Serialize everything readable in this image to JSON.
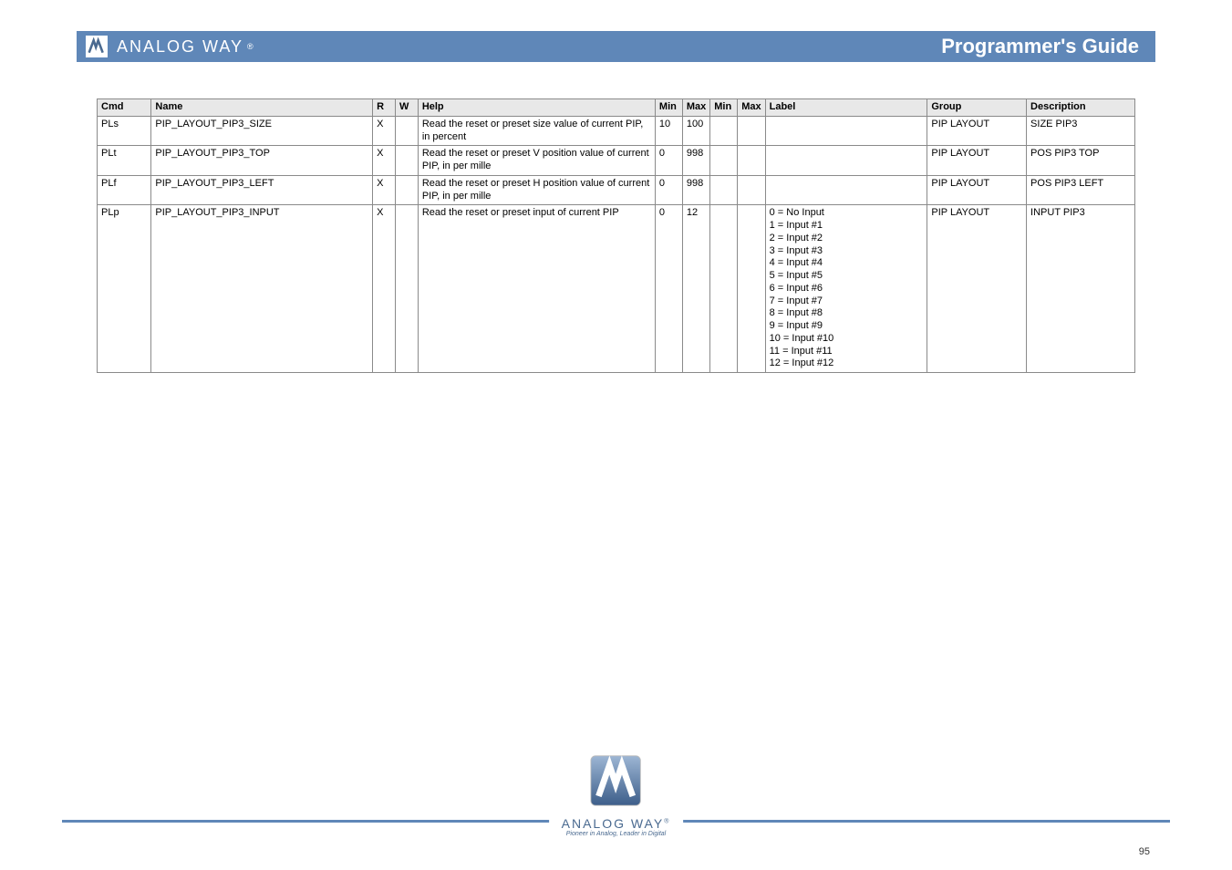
{
  "header": {
    "brand": "ANALOG WAY",
    "brand_suffix": "®",
    "title": "Programmer's Guide"
  },
  "table": {
    "headers": [
      "Cmd",
      "Name",
      "R",
      "W",
      "Help",
      "Min",
      "Max",
      "Min",
      "Max",
      "Label",
      "Group",
      "Description"
    ],
    "rows": [
      {
        "cmd": "PLs",
        "name": "PIP_LAYOUT_PIP3_SIZE",
        "r": "X",
        "w": "",
        "help": "Read the reset or preset size value of current PIP, in percent",
        "min": "10",
        "max": "100",
        "min2": "",
        "max2": "",
        "label": "",
        "group": "PIP LAYOUT",
        "desc": "SIZE PIP3"
      },
      {
        "cmd": "PLt",
        "name": "PIP_LAYOUT_PIP3_TOP",
        "r": "X",
        "w": "",
        "help": "Read the reset or preset V position value of current PIP, in per mille",
        "min": "0",
        "max": "998",
        "min2": "",
        "max2": "",
        "label": "",
        "group": "PIP LAYOUT",
        "desc": "POS PIP3 TOP"
      },
      {
        "cmd": "PLf",
        "name": "PIP_LAYOUT_PIP3_LEFT",
        "r": "X",
        "w": "",
        "help": "Read the reset or preset H position value of current PIP, in per mille",
        "min": "0",
        "max": "998",
        "min2": "",
        "max2": "",
        "label": "",
        "group": "PIP LAYOUT",
        "desc": "POS PIP3 LEFT"
      },
      {
        "cmd": "PLp",
        "name": "PIP_LAYOUT_PIP3_INPUT",
        "r": "X",
        "w": "",
        "help": "Read the reset or preset input of current PIP",
        "min": "0",
        "max": "12",
        "min2": "",
        "max2": "",
        "label": "0 = No Input\n1 = Input #1\n2 = Input #2\n3 = Input #3\n4 = Input #4\n5 = Input #5\n6 = Input #6\n7 = Input #7\n8 = Input #8\n9 = Input #9\n10 = Input #10\n11 = Input #11\n12 = Input #12",
        "group": "PIP LAYOUT",
        "desc": "INPUT PIP3"
      }
    ]
  },
  "footer": {
    "brand": "ANALOG WAY",
    "brand_suffix": "®",
    "tagline": "Pioneer in Analog, Leader in Digital",
    "page": "95"
  }
}
